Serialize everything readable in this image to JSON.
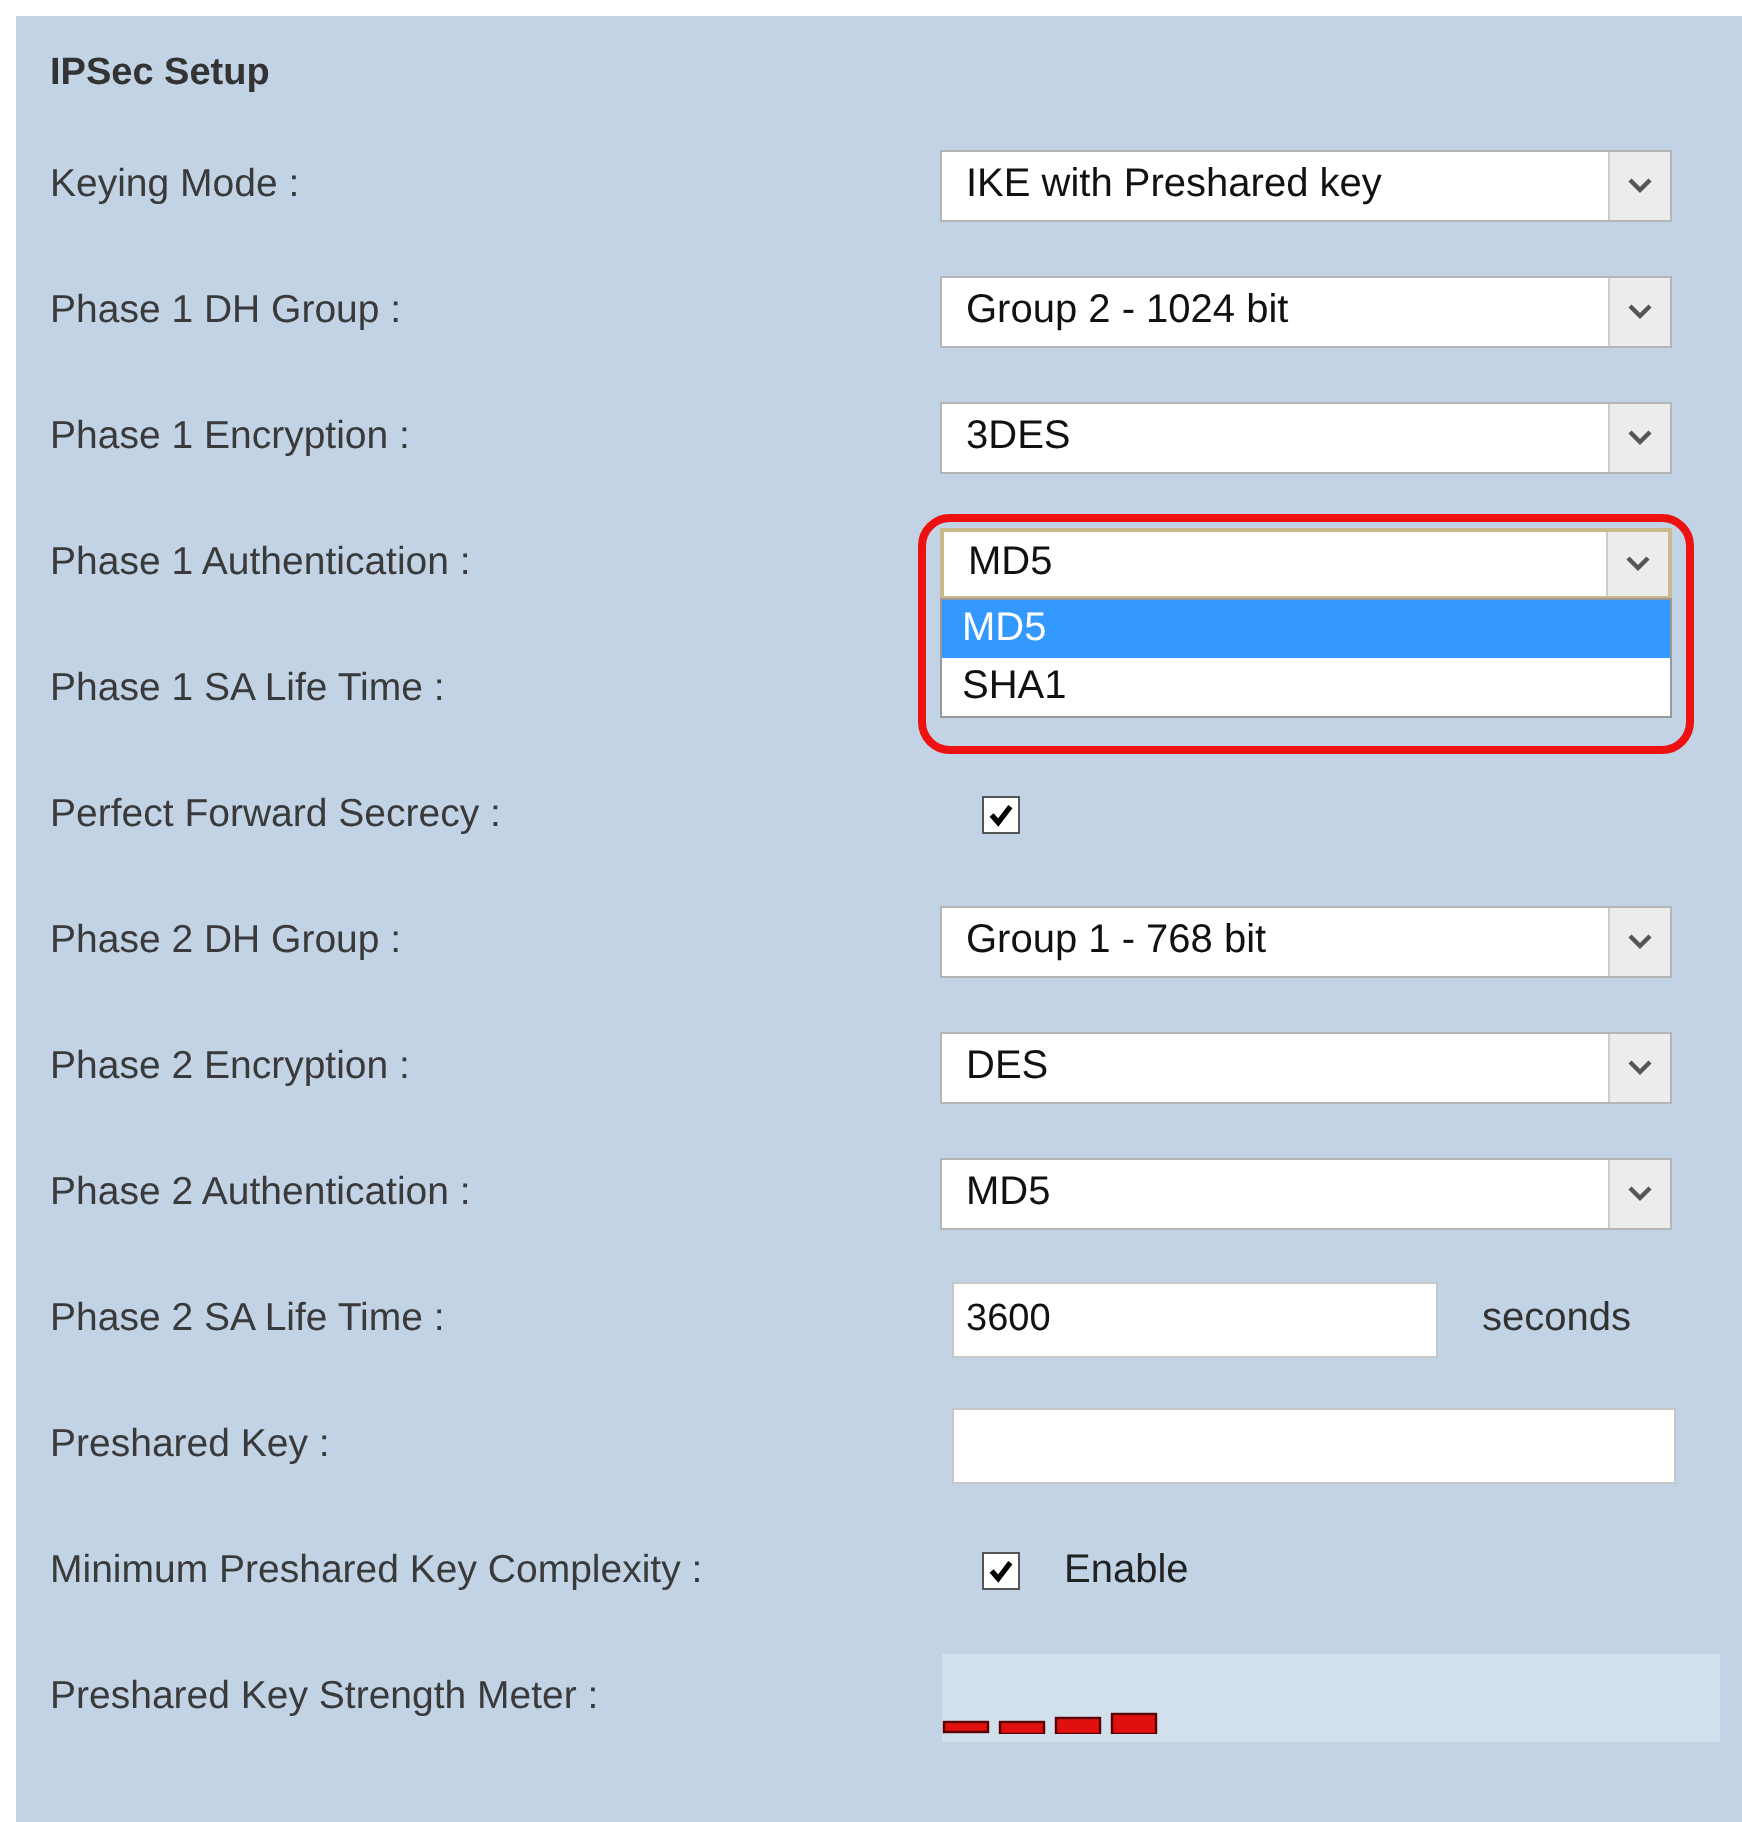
{
  "panel": {
    "title": "IPSec Setup"
  },
  "rows": [
    {
      "kind": "select",
      "label": "Keying Mode :",
      "value": "IKE with Preshared key"
    },
    {
      "kind": "select",
      "label": "Phase 1 DH Group :",
      "value": "Group 2 - 1024 bit"
    },
    {
      "kind": "select",
      "label": "Phase 1 Encryption :",
      "value": "3DES"
    },
    {
      "kind": "select",
      "label": "Phase 1 Authentication :",
      "value": "MD5",
      "expanded": true,
      "highlighted": true,
      "options": [
        {
          "label": "MD5",
          "selected": true
        },
        {
          "label": "SHA1",
          "selected": false
        }
      ]
    },
    {
      "kind": "covered",
      "label": "Phase 1 SA Life Time :"
    },
    {
      "kind": "checkbox",
      "label": "Perfect Forward Secrecy :",
      "checked": true
    },
    {
      "kind": "select",
      "label": "Phase 2 DH Group :",
      "value": "Group 1 - 768 bit"
    },
    {
      "kind": "select",
      "label": "Phase 2 Encryption :",
      "value": "DES"
    },
    {
      "kind": "select",
      "label": "Phase 2 Authentication :",
      "value": "MD5"
    },
    {
      "kind": "text",
      "label": "Phase 2 SA Life Time :",
      "value": "3600",
      "unit": "seconds"
    },
    {
      "kind": "text",
      "label": "Preshared Key :",
      "wide": true
    },
    {
      "kind": "checkbox",
      "label": "Minimum Preshared Key Complexity :",
      "checked": true,
      "caption": "Enable"
    },
    {
      "kind": "meter",
      "label": "Preshared Key Strength Meter :"
    }
  ]
}
